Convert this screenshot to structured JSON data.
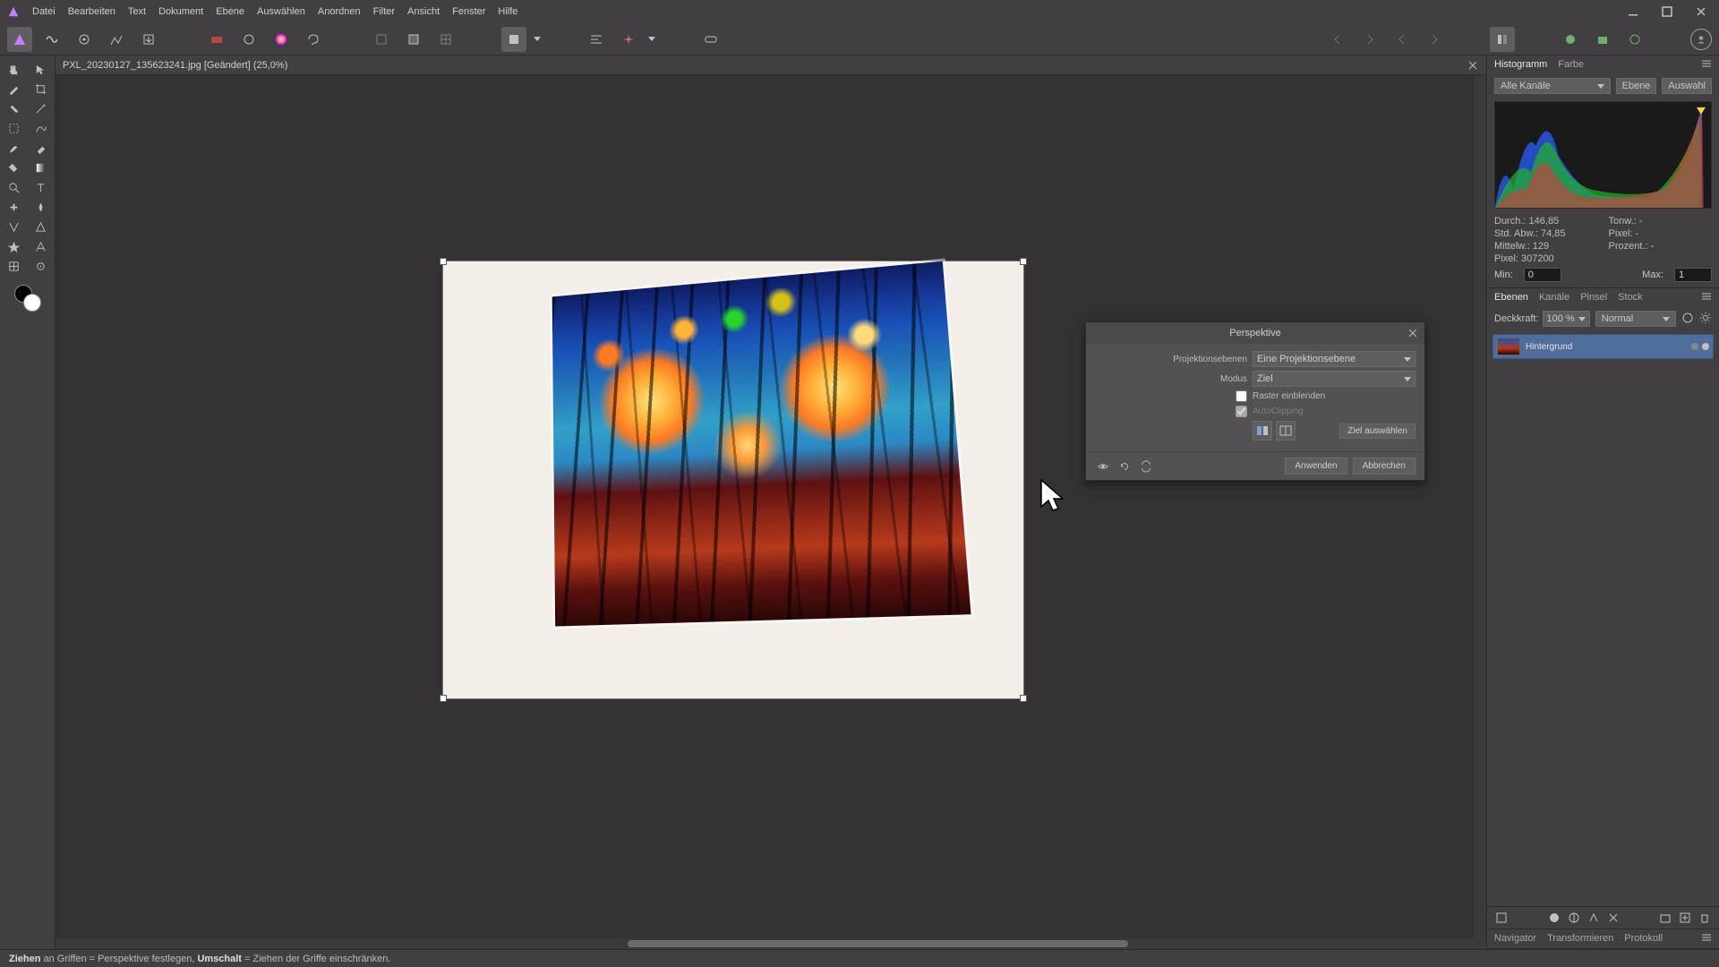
{
  "menu": [
    "Datei",
    "Bearbeiten",
    "Text",
    "Dokument",
    "Ebene",
    "Auswählen",
    "Anordnen",
    "Filter",
    "Ansicht",
    "Fenster",
    "Hilfe"
  ],
  "document": {
    "tab_label": "PXL_20230127_135623241.jpg [Geändert] (25,0%)"
  },
  "dialog": {
    "title": "Perspektive",
    "proj_label": "Projektionsebenen",
    "proj_value": "Eine Projektionsebene",
    "mode_label": "Modus",
    "mode_value": "Ziel",
    "check_raster": "Raster einblenden",
    "check_autoclip": "AutoClipping",
    "target_btn": "Ziel auswählen",
    "apply": "Anwenden",
    "cancel": "Abbrechen"
  },
  "histogram": {
    "tabs": [
      "Histogramm",
      "Farbe"
    ],
    "channels": "Alle Kanäle",
    "btn_ebene": "Ebene",
    "btn_auswahl": "Auswahl",
    "stats": {
      "durch_l": "Durch.:",
      "durch_v": "146,85",
      "std_l": "Std. Abw.:",
      "std_v": "74,85",
      "mittelw_l": "Mittelw.:",
      "mittelw_v": "129",
      "pixel_l": "Pixel:",
      "pixel_v": "307200",
      "tonw_l": "Tonw.:",
      "tonw_v": "-",
      "pix2_l": "Pixel:",
      "pix2_v": "-",
      "proz_l": "Prozent.:",
      "proz_v": "-"
    },
    "min_l": "Min:",
    "min_v": "0",
    "max_l": "Max:",
    "max_v": "1"
  },
  "layers": {
    "tabs": [
      "Ebenen",
      "Kanäle",
      "Pinsel",
      "Stock"
    ],
    "opacity_l": "Deckkraft:",
    "opacity_v": "100 %",
    "blend": "Normal",
    "layer_name": "Hintergrund"
  },
  "bottom_tabs": [
    "Navigator",
    "Transformieren",
    "Protokoll"
  ],
  "status": {
    "t1": "Ziehen",
    "t2": " an Griffen = Perspektive festlegen, ",
    "t3": "Umschalt",
    "t4": " = Ziehen der Griffe einschränken."
  }
}
